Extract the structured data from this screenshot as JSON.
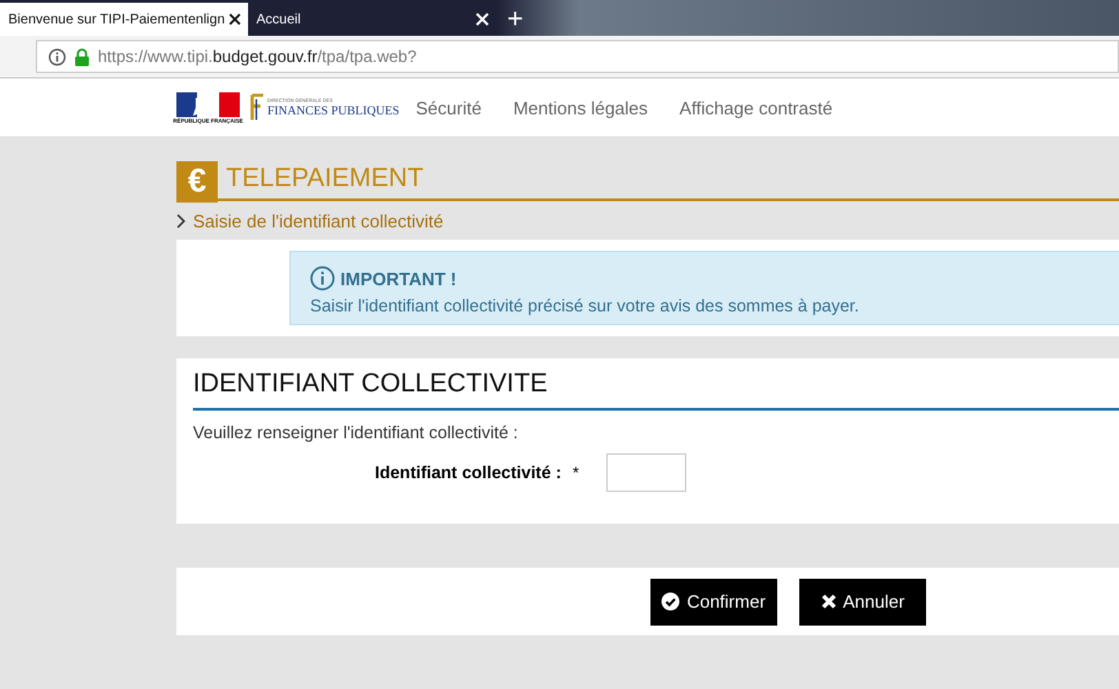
{
  "browser": {
    "tabs": [
      {
        "title": "Bienvenue sur TIPI-Paiementenlign",
        "selected": true
      },
      {
        "title": "Accueil",
        "selected": false
      }
    ],
    "new_tab": "+",
    "url": "https://www.tipi.**budget.gouv.fr**/tpa/tpa.web?"
  },
  "header": {
    "logo_republique": "RÉPUBLIQUE FRANÇAISE",
    "logo_dgfip_top": "DIRECTION GÉNÉRALE DES",
    "logo_dgfip": "FINANCES PUBLIQUES",
    "nav": [
      "Sécurité",
      "Mentions légales",
      "Affichage contrasté"
    ]
  },
  "page": {
    "icon": "€",
    "title": "TELEPAIEMENT",
    "breadcrumb": "Saisie de l'identifiant collectivité"
  },
  "alert": {
    "title": "IMPORTANT !",
    "text": "Saisir l'identifiant collectivité précisé sur votre avis des sommes à payer."
  },
  "form": {
    "title": "IDENTIFIANT COLLECTIVITE",
    "instruction": "Veuillez renseigner l'identifiant collectivité :",
    "field_label": "Identifiant collectivité :",
    "required_mark": "*"
  },
  "buttons": [
    {
      "kind": "confirm",
      "label": "Confirmer"
    },
    {
      "kind": "cancel",
      "label": "Annuler"
    }
  ]
}
